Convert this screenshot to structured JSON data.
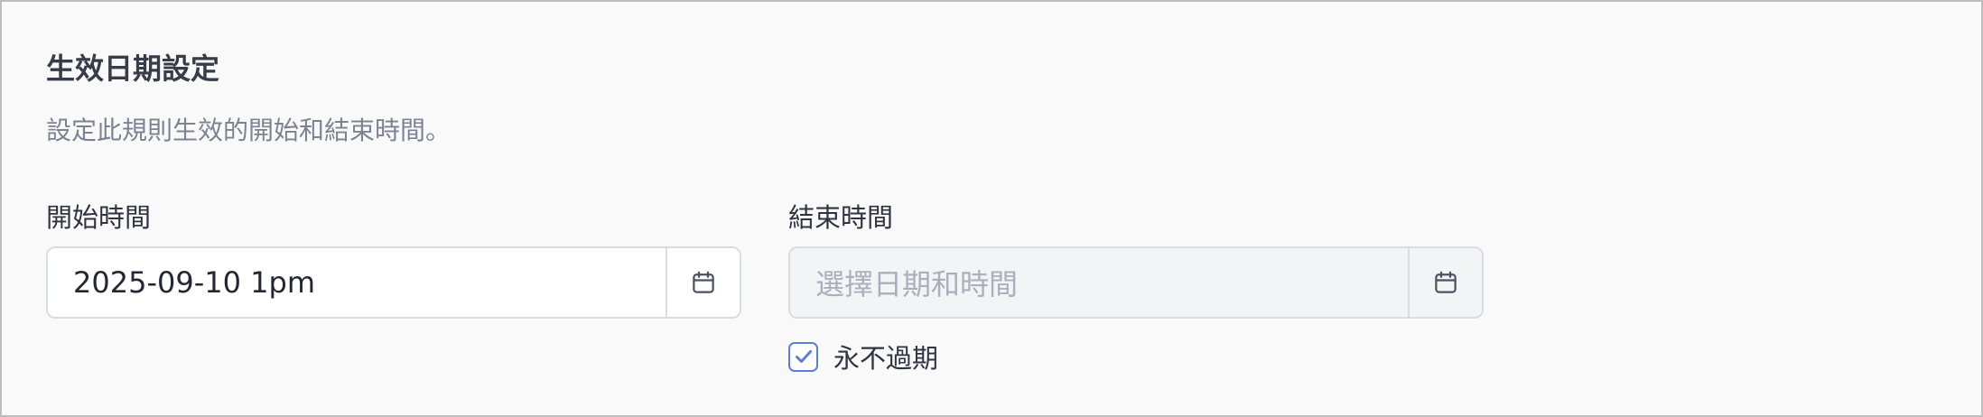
{
  "section": {
    "title": "生效日期設定",
    "description": "設定此規則生效的開始和結束時間。"
  },
  "start": {
    "label": "開始時間",
    "value": "2025-09-10 1pm",
    "icon": "calendar-icon"
  },
  "end": {
    "label": "結束時間",
    "placeholder": "選擇日期和時間",
    "icon": "calendar-icon"
  },
  "never_expire": {
    "label": "永不過期",
    "checked": true
  },
  "colors": {
    "accent": "#5b7fd6",
    "title_text": "#373c4a",
    "muted_text": "#7b8393",
    "border": "#d8dde5"
  }
}
